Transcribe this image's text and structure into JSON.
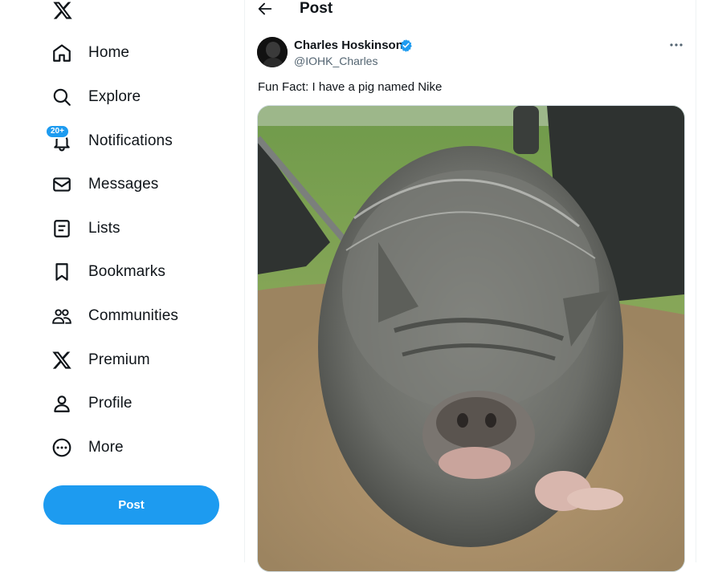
{
  "nav": {
    "logo_icon": "x-logo-icon",
    "items": [
      {
        "label": "Home",
        "icon": "home-icon"
      },
      {
        "label": "Explore",
        "icon": "search-icon"
      },
      {
        "label": "Notifications",
        "icon": "bell-icon",
        "badge": "20+"
      },
      {
        "label": "Messages",
        "icon": "mail-icon"
      },
      {
        "label": "Lists",
        "icon": "list-icon"
      },
      {
        "label": "Bookmarks",
        "icon": "bookmark-icon"
      },
      {
        "label": "Communities",
        "icon": "communities-icon"
      },
      {
        "label": "Premium",
        "icon": "x-logo-icon"
      },
      {
        "label": "Profile",
        "icon": "person-icon"
      },
      {
        "label": "More",
        "icon": "more-circle-icon"
      }
    ],
    "post_label": "Post"
  },
  "header": {
    "title": "Post",
    "back_icon": "back-arrow-icon"
  },
  "tweet": {
    "author_name": "Charles Hoskinson",
    "author_handle": "@IOHK_Charles",
    "verified_icon": "verified-badge-icon",
    "text": "Fun Fact: I have a pig named Nike",
    "media_description_icon": "photo-pig"
  },
  "colors": {
    "accent": "#1d9bf0",
    "text": "#0f1419",
    "secondary": "#536471"
  }
}
